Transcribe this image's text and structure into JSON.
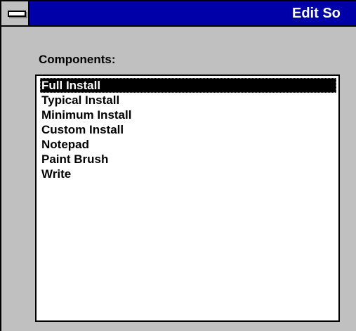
{
  "window": {
    "title": "Edit So"
  },
  "components": {
    "label": "Components:",
    "items": [
      {
        "label": "Full Install",
        "selected": true
      },
      {
        "label": "Typical Install",
        "selected": false
      },
      {
        "label": "Minimum Install",
        "selected": false
      },
      {
        "label": "Custom Install",
        "selected": false
      },
      {
        "label": "Notepad",
        "selected": false
      },
      {
        "label": "Paint Brush",
        "selected": false
      },
      {
        "label": "Write",
        "selected": false
      }
    ]
  },
  "colors": {
    "titlebar": "#0000a8",
    "window_bg": "#c0c0c0",
    "selection": "#000000"
  }
}
